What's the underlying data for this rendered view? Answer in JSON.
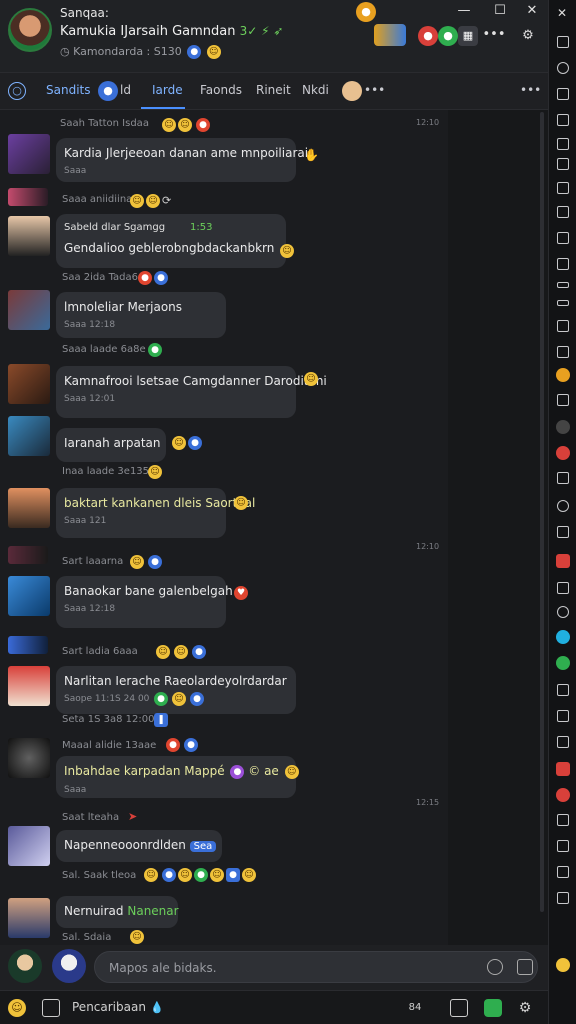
{
  "header": {
    "app_label": "Sanqaa:",
    "chat_title": "Kamukia IJarsaih Gamndan",
    "chat_title_suffix": "3✓ ⚡ ➶",
    "subtitle": "Kamondarda : S130",
    "minimize": "—",
    "maximize": "☐",
    "close": "✕",
    "more": "•••"
  },
  "tabs": {
    "first": "Sandits",
    "count": "ld",
    "items": [
      "Iarde",
      "Faonds",
      "Rineit",
      "Nkdi"
    ],
    "more": "•••"
  },
  "messages": [
    {
      "meta": "Saah Tatton Isdaa",
      "text": "Kardia Jlerjeeoan danan ame mnpoiliarai",
      "sub": "Saaa",
      "time": "12:10",
      "colors": [
        "#6b3fa0",
        "#2a2035"
      ]
    },
    {
      "meta": "Saaa aniidiina",
      "text": "",
      "sub": "",
      "time": "",
      "colors": [
        "#c44b6d",
        "#2a1c26"
      ]
    },
    {
      "meta": "Sabeld dlar Sgamgg · 181",
      "meta_extra": "1:53",
      "text": "Sabeld dlar Sgamgg",
      "text2": "Gendalioo geblerobngbdackanbkrn",
      "sub": "",
      "time": "",
      "colors": [
        "#e7c7a8",
        "#222"
      ]
    },
    {
      "meta": "Saa 2ida Tada6",
      "text": "",
      "sub": "",
      "time": "",
      "colors": [
        "#a33",
        "#223"
      ]
    },
    {
      "meta": "",
      "text": "lmnoleliar Merjaons",
      "sub": "Saaa 12:18",
      "time": "",
      "colors": [
        "#7a3a3a",
        "#3a6a9a"
      ]
    },
    {
      "meta": "Saaa laade 6a8e",
      "text": "",
      "sub": "",
      "time": "",
      "colors": []
    },
    {
      "meta": "",
      "text": "Kamnafrooi lsetsae Camgdanner Daroditani",
      "sub": "Saaa 12:01",
      "time": "",
      "colors": [
        "#8a4a2a",
        "#2a1a12"
      ]
    },
    {
      "meta": "",
      "text": "Iaranah arpatan",
      "sub": "Saaa 12:00",
      "time": "",
      "colors": [
        "#3a8ac0",
        "#1a2a3a"
      ]
    },
    {
      "meta": "Inaa laade 3e135",
      "text": "",
      "sub": "",
      "time": "",
      "colors": []
    },
    {
      "meta": "",
      "text": "baktart kankanen dleis Saortaal",
      "sub": "Saaa 121",
      "time": "",
      "colors": [
        "#e09060",
        "#3a2a20"
      ]
    },
    {
      "meta": "Sart laaarna",
      "text": "",
      "sub": "",
      "time": "12:10",
      "colors": [
        "#5a2a3a",
        "#1a1a1a"
      ]
    },
    {
      "meta": "",
      "text": "Banaokar bane galenbelgah",
      "sub": "Saaa 12:18",
      "time": "",
      "colors": [
        "#3a8ad8",
        "#0a3a6a"
      ]
    },
    {
      "meta": "Sart ladia 6aaa",
      "text": "",
      "sub": "",
      "time": "",
      "colors": [
        "#3a6ad8",
        "#10203a"
      ]
    },
    {
      "meta": "",
      "text": "Narlitan Ierache Raeolardeyolrdardar",
      "sub": "Saope 11:1S 24 00",
      "time": "",
      "colors": [
        "#d8403a",
        "#f0e0d0"
      ]
    },
    {
      "meta": "Seta 1S 3a8 12:00",
      "text": "",
      "sub": "",
      "time": "",
      "colors": []
    },
    {
      "meta": "Maaal alidie 13aae",
      "text": "",
      "sub": "",
      "time": "",
      "colors": [
        "#303030",
        "#101010"
      ]
    },
    {
      "meta": "",
      "text": "Inbahdae karpadan Mappé",
      "text_extra": "© ae",
      "sub": "Saaa",
      "time": "12:15",
      "colors": []
    },
    {
      "meta": "Saat lteaha",
      "text": "",
      "sub": "",
      "time": "",
      "colors": [
        "#5a5a9a",
        "#d0d0f0"
      ]
    },
    {
      "meta": "",
      "text": "Napenneooonrdlden",
      "tag": "Sea",
      "sub": "",
      "time": "",
      "colors": [
        "#6a6ab0",
        "#e0e0f0"
      ]
    },
    {
      "meta": "Sal. Saak tleoa",
      "text": "",
      "sub": "",
      "time": "",
      "colors": []
    },
    {
      "meta": "",
      "text": "Nernuirad",
      "text_green": "Nanenar",
      "sub": "",
      "time": "",
      "colors": [
        "#2a3a6a",
        "#d0a080"
      ]
    },
    {
      "meta": "Sal. Sdaia",
      "text": "",
      "sub": "",
      "time": "",
      "colors": []
    }
  ],
  "composer": {
    "placeholder": "Mapos ale bidaks."
  },
  "bottom": {
    "label": "Pencaribaan",
    "extra": "84"
  },
  "colors": {
    "background": "#1b1c1f",
    "bubble": "#2e3035",
    "accent": "#4a90ff"
  }
}
